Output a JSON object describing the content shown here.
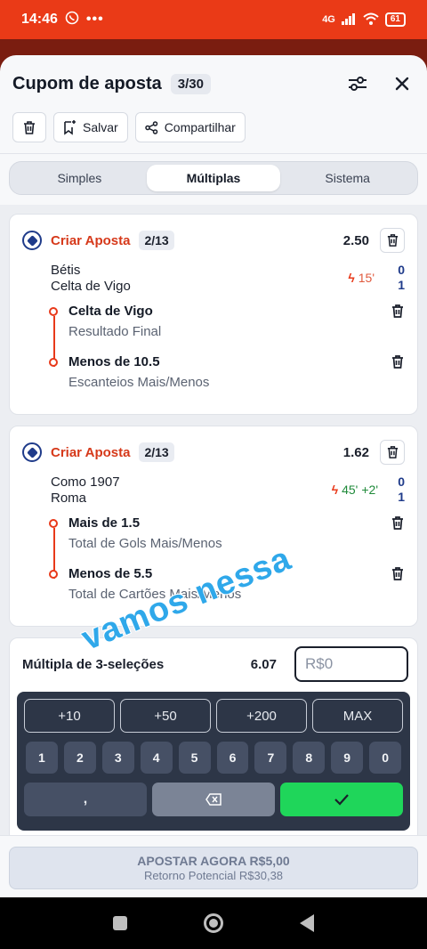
{
  "status_bar": {
    "time": "14:46",
    "network": "4G",
    "battery": "61"
  },
  "header": {
    "title": "Cupom de aposta",
    "count": "3/30"
  },
  "actions": {
    "save_label": "Salvar",
    "share_label": "Compartilhar"
  },
  "tabs": [
    {
      "label": "Simples",
      "active": false
    },
    {
      "label": "Múltiplas",
      "active": true
    },
    {
      "label": "Sistema",
      "active": false
    }
  ],
  "bets": [
    {
      "label": "Criar Aposta",
      "count": "2/13",
      "odds": "2.50",
      "home": "Bétis",
      "away": "Celta de Vigo",
      "minute": "15'",
      "added": "",
      "score_home": "0",
      "score_away": "1",
      "selections": [
        {
          "name": "Celta de Vigo",
          "market": "Resultado Final"
        },
        {
          "name": "Menos de 10.5",
          "market": "Escanteios Mais/Menos"
        }
      ]
    },
    {
      "label": "Criar Aposta",
      "count": "2/13",
      "odds": "1.62",
      "home": "Como 1907",
      "away": "Roma",
      "minute": "45'",
      "added": "+2'",
      "score_home": "0",
      "score_away": "1",
      "selections": [
        {
          "name": "Mais de 1.5",
          "market": "Total de Gols Mais/Menos"
        },
        {
          "name": "Menos de 5.5",
          "market": "Total de Cartões Mais/Menos"
        }
      ]
    }
  ],
  "multiple": {
    "label": "Múltipla de 3-seleções",
    "odds": "6.07",
    "stake_placeholder": "R$0"
  },
  "keypad": {
    "quick": [
      "+10",
      "+50",
      "+200",
      "MAX"
    ],
    "digits": [
      "1",
      "2",
      "3",
      "4",
      "5",
      "6",
      "7",
      "8",
      "9",
      "0"
    ],
    "comma": ","
  },
  "footer": {
    "bet_label": "APOSTAR AGORA R$5,00",
    "return_label": "Retorno Potencial R$30,38"
  },
  "overlay_text": "vamos nessa",
  "colors": {
    "brand_red": "#ea3a17",
    "accent_red": "#d6391a",
    "confirm_green": "#1fd65a",
    "keypad_bg": "#2d3647"
  }
}
